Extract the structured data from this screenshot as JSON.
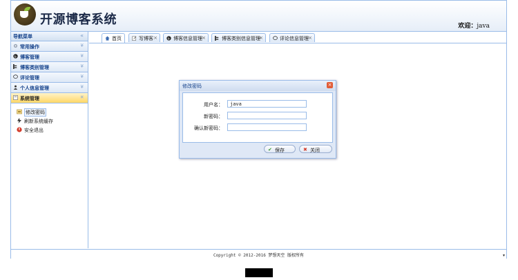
{
  "app": {
    "title": "开源博客系统",
    "welcome_label": "欢迎：",
    "welcome_user": "java"
  },
  "sidebar": {
    "header": "导航菜单",
    "sections": [
      {
        "label": "常用操作",
        "icon": "gear-icon"
      },
      {
        "label": "博客管理",
        "icon": "blog-icon"
      },
      {
        "label": "博客类别管理",
        "icon": "category-icon"
      },
      {
        "label": "评论管理",
        "icon": "comment-icon"
      },
      {
        "label": "个人信息管理",
        "icon": "user-icon"
      },
      {
        "label": "系统管理",
        "icon": "system-icon"
      }
    ],
    "sub_items": [
      {
        "label": "修改密码",
        "icon": "password-icon"
      },
      {
        "label": "刷新系统缓存",
        "icon": "refresh-icon"
      },
      {
        "label": "安全退出",
        "icon": "exit-icon"
      }
    ]
  },
  "tabs": [
    {
      "label": "首页",
      "icon": "home-icon"
    },
    {
      "label": "写博客",
      "icon": "write-icon"
    },
    {
      "label": "博客信息管理",
      "icon": "blog-icon"
    },
    {
      "label": "博客类别信息管理",
      "icon": "category-icon"
    },
    {
      "label": "评论信息管理",
      "icon": "comment-icon"
    }
  ],
  "tab_close": "×",
  "dialog": {
    "title": "修改密码",
    "close": "×",
    "fields": [
      {
        "label": "用户名：",
        "value": "java"
      },
      {
        "label": "新密码：",
        "value": ""
      },
      {
        "label": "确认新密码：",
        "value": ""
      }
    ],
    "save_label": "保存",
    "close_label": "关闭"
  },
  "footer": {
    "text": "Copyright © 2012-2016 梦想天空 版权所有"
  },
  "colors": {
    "border": "#99bbe8",
    "header_text": "#15428b",
    "active_section": "#ffd766"
  }
}
